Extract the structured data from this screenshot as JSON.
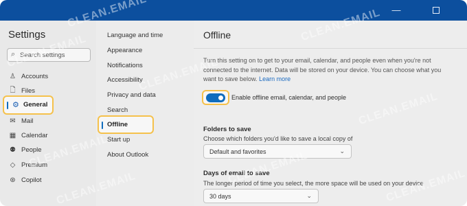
{
  "watermark": "CLEAN.EMAIL",
  "window": {
    "minimize_glyph": "—",
    "colors": {
      "titlebar": "#0c4f9e",
      "accent": "#0f6cbd",
      "highlight": "#f5c14b"
    }
  },
  "sidebar": {
    "title": "Settings",
    "search_placeholder": "Search settings",
    "items": [
      {
        "label": "Accounts",
        "icon": "person-icon"
      },
      {
        "label": "Files",
        "icon": "file-icon"
      },
      {
        "label": "General",
        "icon": "gear-icon",
        "selected": true
      },
      {
        "label": "Mail",
        "icon": "mail-icon"
      },
      {
        "label": "Calendar",
        "icon": "calendar-icon"
      },
      {
        "label": "People",
        "icon": "people-icon"
      },
      {
        "label": "Premium",
        "icon": "diamond-icon"
      },
      {
        "label": "Copilot",
        "icon": "copilot-icon"
      }
    ]
  },
  "subnav": {
    "items": [
      {
        "label": "Language and time"
      },
      {
        "label": "Appearance"
      },
      {
        "label": "Notifications"
      },
      {
        "label": "Accessibility"
      },
      {
        "label": "Privacy and data"
      },
      {
        "label": "Search"
      },
      {
        "label": "Offline",
        "selected": true
      },
      {
        "label": "Start up"
      },
      {
        "label": "About Outlook"
      }
    ]
  },
  "main": {
    "title": "Offline",
    "description": "Turn this setting on to get to your email, calendar, and people even when you're not connected to the internet. Data will be stored on your device. You can choose what you want to save below.",
    "learn_more": "Learn more",
    "toggle": {
      "label": "Enable offline email, calendar, and people",
      "on": true
    },
    "folders": {
      "heading": "Folders to save",
      "description": "Choose which folders you'd like to save a local copy of",
      "value": "Default and favorites"
    },
    "days": {
      "heading": "Days of email to save",
      "description": "The longer period of time you select, the more space will be used on your device",
      "value": "30 days"
    }
  }
}
